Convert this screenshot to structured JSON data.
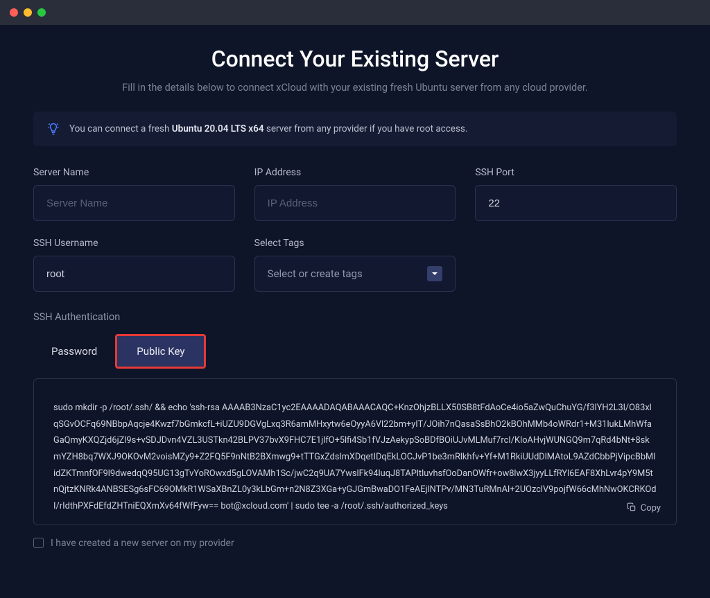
{
  "header": {
    "title": "Connect Your Existing Server",
    "subtitle": "Fill in the details below to connect xCloud with your existing fresh Ubuntu server from any cloud provider."
  },
  "banner": {
    "prefix": "You can connect a fresh ",
    "bold": "Ubuntu 20.04 LTS x64",
    "suffix": " server from any provider if you have root access."
  },
  "fields": {
    "server_name": {
      "label": "Server Name",
      "placeholder": "Server Name",
      "value": ""
    },
    "ip_address": {
      "label": "IP Address",
      "placeholder": "IP Address",
      "value": ""
    },
    "ssh_port": {
      "label": "SSH Port",
      "placeholder": "",
      "value": "22"
    },
    "ssh_username": {
      "label": "SSH Username",
      "placeholder": "",
      "value": "root"
    },
    "tags": {
      "label": "Select Tags",
      "placeholder": "Select or create tags"
    }
  },
  "ssh_auth": {
    "label": "SSH Authentication",
    "tabs": {
      "password": "Password",
      "public_key": "Public Key"
    },
    "command": "sudo mkdir -p /root/.ssh/ && echo 'ssh-rsa AAAAB3NzaC1yc2EAAAADAQABAAACAQC+KnzOhjzBLLX50SB8tFdAoCe4io5aZwQuChuYG/f3lYH2L3l/O83xlqSGvOCFq69NBbpAqcje4Kwzf7bGmkcfL+iUZU9DGVgLxq3R6amMHxytw6eOyyA6Vl22bm+yIT/JOih7nQasaSsBhO2kBOhMMb4oWRdr1+M31lukLMhWfaGaQmyKXQZjd6jZl9s+vSDJDvn4VZL3USTkn42BLPV37bvX9FHC7E1jlfO+5lfi4Sb1fVJzAekypSoBDfBOiUJvMLMuf7rcI/KloAHvjWUNGQ9m7qRd4bNt+8skmYZH8bq7WXJ9OKOvM2voisMZy9+Z2FQ5F9nNtB2BXmwg9+tTTGxZdslmXDqetIDqEkLOCJvP1be3mRlkhfv+Yf+M1RkiUUdDlMAtoL9AZdCbbPjVipcBbMlidZKTmnfOF9l9dwedqQ95UG13gTvYoROwxd5gLOVAMh1Sc/jwC2q9UA7YwslFk94luqJ8TAPltluvhsfOoDanOWfr+ow8lwX3jyyLLfRYl6EAF8XhLvr4pY9M5tnQjtzKNRk4ANBSESg6sFC69OMkR1WSaXBnZL0y3kLbGm+n2N8Z3XGa+yGJGmBwaDO1FeAEjlNTPv/MN3TuRMnAI+2UOzclV9pojfW66cMhNwOKCRKOdI/rIdthPXFdEfdZHTniEQXmXv64fWfFyw== bot@xcloud.com' | sudo tee -a /root/.ssh/authorized_keys",
    "copy_label": "Copy"
  },
  "confirm": {
    "label": "I have created a new server on my provider"
  }
}
